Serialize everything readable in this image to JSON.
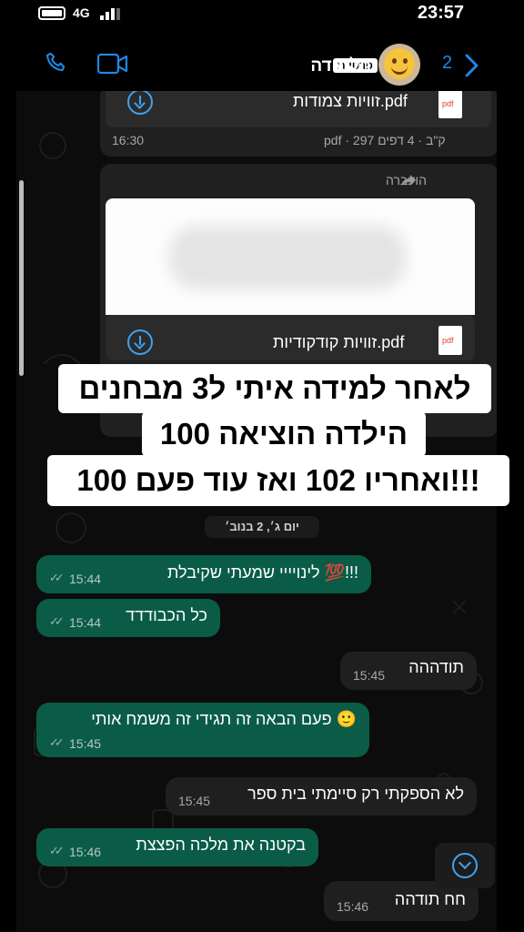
{
  "status_bar": {
    "network": "4G",
    "time": "23:57"
  },
  "header": {
    "contact_name": "תלמידה",
    "tag": "פרטיות",
    "back_count": "2",
    "icons": [
      "phone-icon",
      "video-icon",
      "back-chevron-icon"
    ]
  },
  "messages": {
    "doc1": {
      "file_name": "זוויות צמודות.pdf",
      "pages": "4 דפים",
      "size": "297 ק\"ב",
      "type": "pdf",
      "time": "16:30"
    },
    "doc2": {
      "forwarded_label": "הועברה",
      "file_name": "זוויות קודקודיות.pdf"
    },
    "date_separator": "יום ג׳, 2 בנוב׳",
    "list": [
      {
        "text": "לינויייי שמעתי שקיבלת 💯!!!",
        "time": "15:44",
        "direction": "out"
      },
      {
        "text": "כל הכבודדד",
        "time": "15:44",
        "direction": "out"
      },
      {
        "text": "תודההה",
        "time": "15:45",
        "direction": "in"
      },
      {
        "text": "פעם הבאה זה תגידי זה משמח אותי 🙂",
        "time": "15:45",
        "direction": "out"
      },
      {
        "text": "לא הספקתי רק סיימתי בית ספר",
        "time": "15:45",
        "direction": "in"
      },
      {
        "text": "בקטנה את מלכה הפצצת",
        "time": "15:46",
        "direction": "out"
      },
      {
        "text": "חח תודהה",
        "time": "15:46",
        "direction": "in"
      }
    ]
  },
  "overlay": {
    "lines": [
      "לאחר למידה איתי ל3 מבחנים",
      "הילדה הוציאה 100",
      "ואחריו 102 ואז עוד פעם 100!!!"
    ]
  },
  "colors": {
    "accent": "#1e88e5",
    "outgoing_bubble": "#0a5c47",
    "incoming_bubble": "#1f1f1f"
  }
}
